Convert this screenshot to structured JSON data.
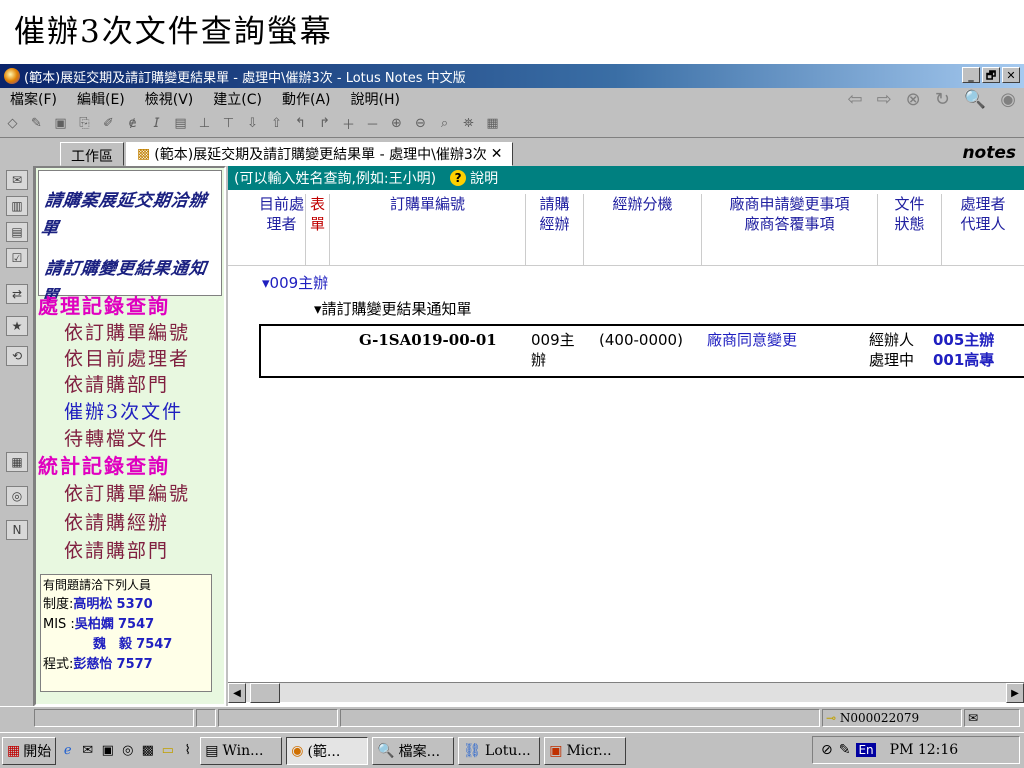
{
  "heading": "催辦3次文件查詢螢幕",
  "window": {
    "title": "(範本)展延交期及請訂購變更結果單 - 處理中\\催辦3次 - Lotus Notes 中文版",
    "controls": [
      "_",
      "🗗",
      "✕"
    ]
  },
  "menu": [
    "檔案(F)",
    "編輯(E)",
    "檢視(V)",
    "建立(C)",
    "動作(A)",
    "說明(H)"
  ],
  "tabs": {
    "workspace": "工作區",
    "doc": "(範本)展延交期及請訂購變更結果單 - 處理中\\催辦3次",
    "close": "✕"
  },
  "notes_logo": "notes",
  "nav": {
    "banner_line1": "請購案展延交期洽辦單",
    "banner_line2": "請訂購變更結果通知單",
    "section1": "處理記錄查詢",
    "section1_items": [
      "依訂購單編號",
      "依目前處理者",
      "依請購部門",
      "催辦3次文件",
      "待轉檔文件"
    ],
    "section2": "統計記錄查詢",
    "section2_items": [
      "依訂購單編號",
      "依請購經辦",
      "依請購部門"
    ],
    "contact_title": "有問題請洽下列人員",
    "contacts": [
      {
        "role": "制度:",
        "name": "高明松",
        "ext": "5370"
      },
      {
        "role": "MIS :",
        "name": "吳柏嫻",
        "ext": "7547"
      },
      {
        "role": "",
        "name": "魏　毅",
        "ext": "7547"
      },
      {
        "role": "程式:",
        "name": "彭慈怡",
        "ext": "7577"
      }
    ]
  },
  "search_hint": "(可以輸入姓名查詢,例如:王小明)",
  "help_label": "說明",
  "columns": [
    {
      "line1": "目前處",
      "line2": "理者"
    },
    {
      "line1": "表",
      "line2": "單"
    },
    {
      "line1": "訂購單編號",
      "line2": ""
    },
    {
      "line1": "請購",
      "line2": "經辦"
    },
    {
      "line1": "經辦分機",
      "line2": ""
    },
    {
      "line1": "廠商申請變更事項",
      "line2": "廠商答覆事項"
    },
    {
      "line1": "文件",
      "line2": "狀態"
    },
    {
      "line1": "處理者",
      "line2": "代理人"
    }
  ],
  "category1": "▾009主辦",
  "category2": "▾請訂購變更結果通知單",
  "row": {
    "order_no": "G-1SA019-00-01",
    "buyer_l1": "009主",
    "buyer_l2": "辦",
    "ext": "(400-0000)",
    "change": "廠商同意變更",
    "status_l1": "經辦人",
    "status_l2": "處理中",
    "handler_l1": "005主辦",
    "handler_l2": "001高專"
  },
  "status": {
    "doc_id": "N000022079"
  },
  "taskbar": {
    "start": "開始",
    "tasks": [
      "Win...",
      "(範...",
      "檔案...",
      "Lotu...",
      "Micr..."
    ],
    "ime": "En",
    "clock": "PM 12:16"
  }
}
